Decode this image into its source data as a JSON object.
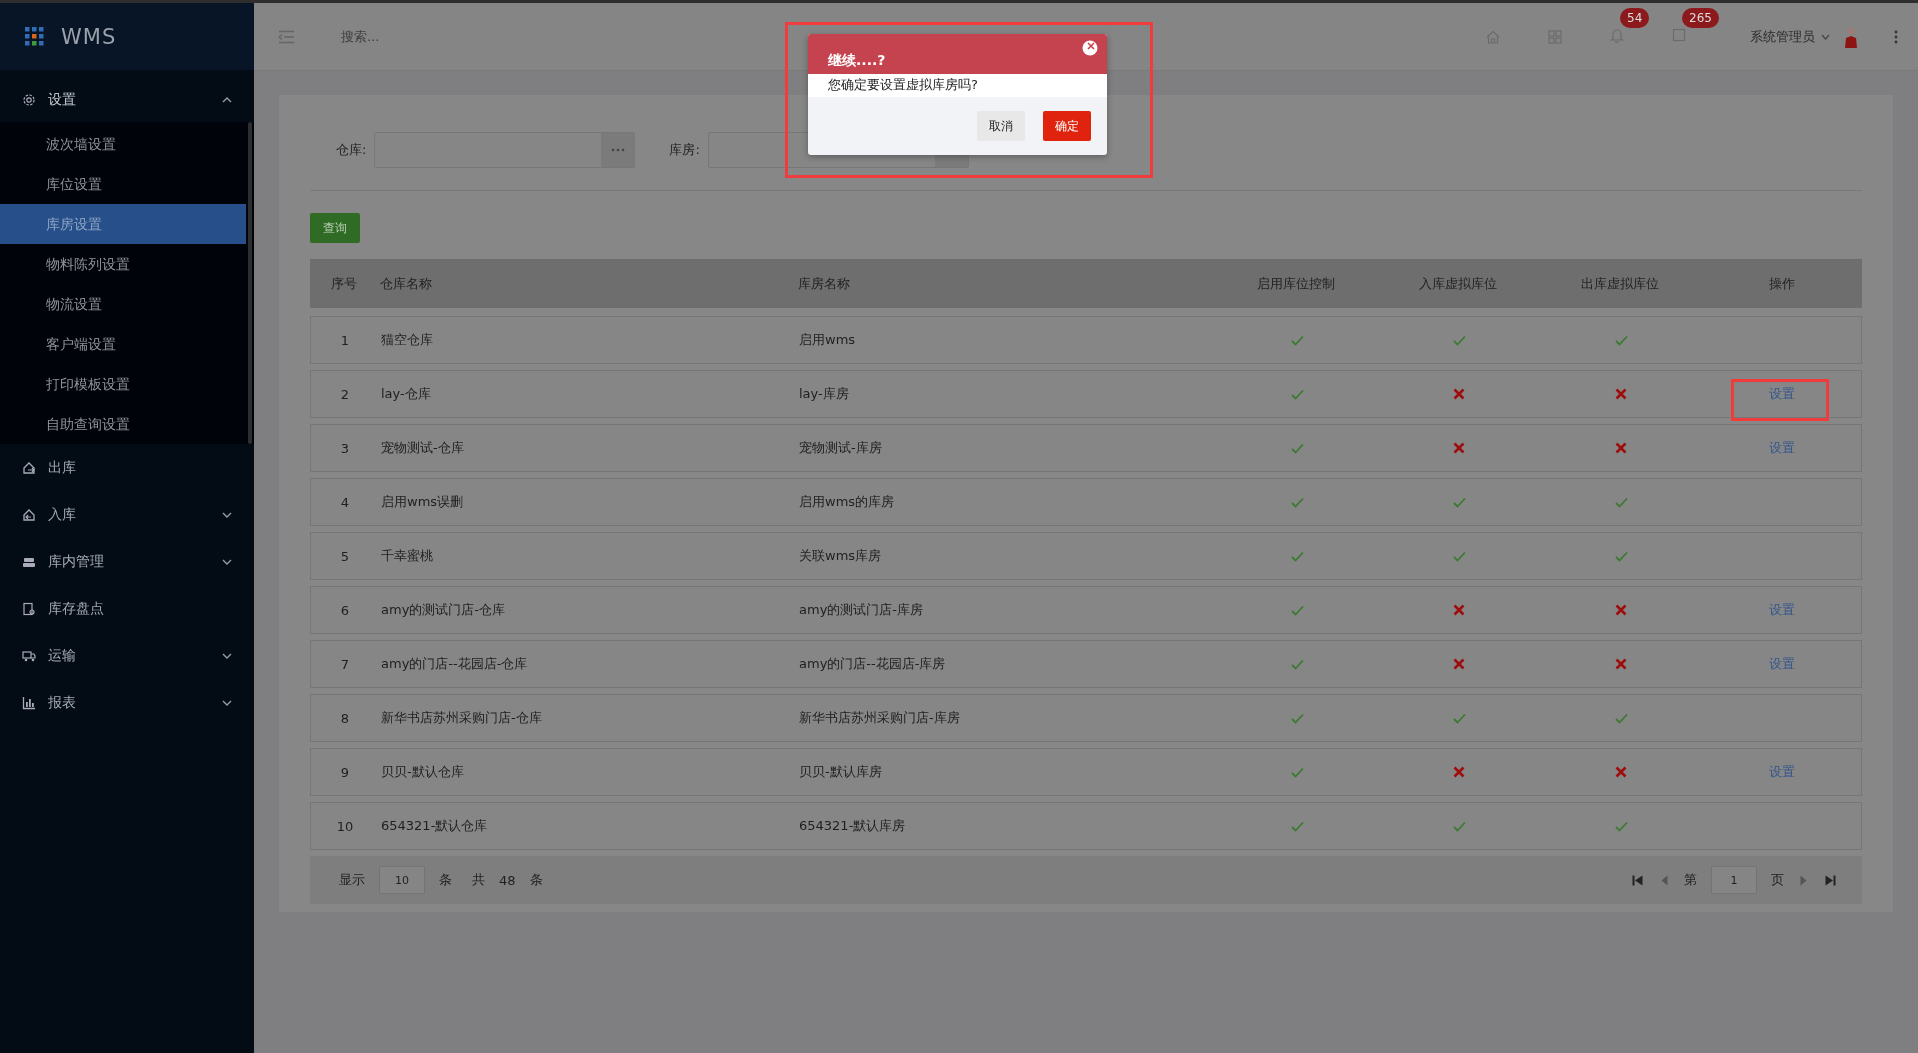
{
  "sidebar": {
    "logo": "WMS",
    "groups": [
      {
        "label": "设置",
        "expandable": true,
        "expanded": true,
        "children": [
          {
            "label": "波次墙设置",
            "selected": false
          },
          {
            "label": "库位设置",
            "selected": false
          },
          {
            "label": "库房设置",
            "selected": true
          },
          {
            "label": "物料陈列设置",
            "selected": false
          },
          {
            "label": "物流设置",
            "selected": false
          },
          {
            "label": "客户端设置",
            "selected": false
          },
          {
            "label": "打印模板设置",
            "selected": false
          },
          {
            "label": "自助查询设置",
            "selected": false
          }
        ]
      },
      {
        "label": "出库",
        "expandable": false
      },
      {
        "label": "入库",
        "expandable": true,
        "expanded": false
      },
      {
        "label": "库内管理",
        "expandable": true,
        "expanded": false
      },
      {
        "label": "库存盘点",
        "expandable": false
      },
      {
        "label": "运输",
        "expandable": true,
        "expanded": false
      },
      {
        "label": "报表",
        "expandable": true,
        "expanded": false
      }
    ]
  },
  "topbar": {
    "search": {
      "placeholder": "搜索..."
    },
    "notification_badge": "54",
    "message_badge": "265",
    "user": "系统管理员"
  },
  "filters": [
    {
      "label": "仓库:"
    },
    {
      "label": "库房:"
    }
  ],
  "query_button": "查询",
  "table": {
    "columns": [
      "序号",
      "仓库名称",
      "库房名称",
      "启用库位控制",
      "入库虚拟库位",
      "出库虚拟库位",
      "操作"
    ],
    "rows": [
      {
        "index": "1",
        "warehouse": "猫空仓库",
        "storehouse": "启用wms",
        "location_control": true,
        "inbound_virtual": true,
        "outbound_virtual": true,
        "highlighted": false
      },
      {
        "index": "2",
        "warehouse": "lay-仓库",
        "storehouse": "lay-库房",
        "location_control": true,
        "inbound_virtual": false,
        "outbound_virtual": false,
        "action": "设置",
        "highlighted": true
      },
      {
        "index": "3",
        "warehouse": "宠物测试-仓库",
        "storehouse": "宠物测试-库房",
        "location_control": true,
        "inbound_virtual": false,
        "outbound_virtual": false,
        "action": "设置",
        "highlighted": false
      },
      {
        "index": "4",
        "warehouse": "启用wms误删",
        "storehouse": "启用wms的库房",
        "location_control": true,
        "inbound_virtual": true,
        "outbound_virtual": true,
        "highlighted": false
      },
      {
        "index": "5",
        "warehouse": "千幸蜜桃",
        "storehouse": "关联wms库房",
        "location_control": true,
        "inbound_virtual": true,
        "outbound_virtual": true,
        "highlighted": false
      },
      {
        "index": "6",
        "warehouse": "amy的测试门店-仓库",
        "storehouse": "amy的测试门店-库房",
        "location_control": true,
        "inbound_virtual": false,
        "outbound_virtual": false,
        "action": "设置",
        "highlighted": false
      },
      {
        "index": "7",
        "warehouse": "amy的门店--花园店-仓库",
        "storehouse": "amy的门店--花园店-库房",
        "location_control": true,
        "inbound_virtual": false,
        "outbound_virtual": false,
        "action": "设置",
        "highlighted": false
      },
      {
        "index": "8",
        "warehouse": "新华书店苏州采购门店-仓库",
        "storehouse": "新华书店苏州采购门店-库房",
        "location_control": true,
        "inbound_virtual": true,
        "outbound_virtual": true,
        "highlighted": false
      },
      {
        "index": "9",
        "warehouse": "贝贝-默认仓库",
        "storehouse": "贝贝-默认库房",
        "location_control": true,
        "inbound_virtual": false,
        "outbound_virtual": false,
        "action": "设置",
        "highlighted": false
      },
      {
        "index": "10",
        "warehouse": "654321-默认仓库",
        "storehouse": "654321-默认库房",
        "location_control": true,
        "inbound_virtual": true,
        "outbound_virtual": true,
        "highlighted": false
      }
    ]
  },
  "pagination": {
    "show_label": "显示",
    "page_size": "10",
    "unit": "条",
    "total_label": "共",
    "total": "48",
    "total_unit": "条",
    "page_label": "第",
    "page": "1",
    "page_unit": "页"
  },
  "dialog": {
    "title": "继续....?",
    "message": "您确定要设置虚拟库房吗?",
    "buttons": [
      "取消",
      "确定"
    ],
    "highlighted": true
  }
}
